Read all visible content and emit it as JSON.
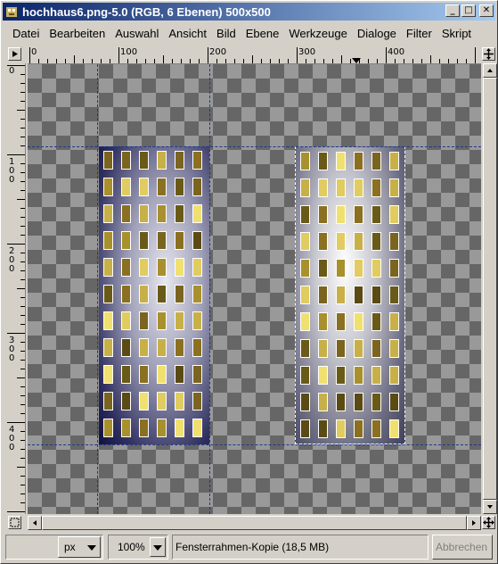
{
  "window": {
    "title": "hochhaus6.png-5.0 (RGB, 6 Ebenen) 500x500",
    "buttons": {
      "minimize": "_",
      "maximize": "□",
      "close": "✕"
    }
  },
  "menu": [
    {
      "label": "Datei"
    },
    {
      "label": "Bearbeiten"
    },
    {
      "label": "Auswahl"
    },
    {
      "label": "Ansicht"
    },
    {
      "label": "Bild"
    },
    {
      "label": "Ebene"
    },
    {
      "label": "Werkzeuge"
    },
    {
      "label": "Dialoge"
    },
    {
      "label": "Filter"
    },
    {
      "label": "Skript"
    }
  ],
  "rulers": {
    "horizontal_labels": [
      "0",
      "100",
      "200",
      "300",
      "400"
    ],
    "vertical_labels": [
      "0",
      "100",
      "200",
      "300",
      "400"
    ]
  },
  "status": {
    "unit": "px",
    "zoom": "100%",
    "message": "Fensterrahmen-Kopie (18,5 MB)",
    "cancel_label": "Abbrechen"
  },
  "colors": {
    "title_start": "#0a246a",
    "title_end": "#a6caf0",
    "guide": "#1a3a8a",
    "window_light": "#f0e070",
    "window_dark": "#6a5a18"
  },
  "icons": {
    "menu_toggle": "triangle-right-icon",
    "nav": "navigate-icon",
    "quickmask": "quickmask-icon"
  }
}
